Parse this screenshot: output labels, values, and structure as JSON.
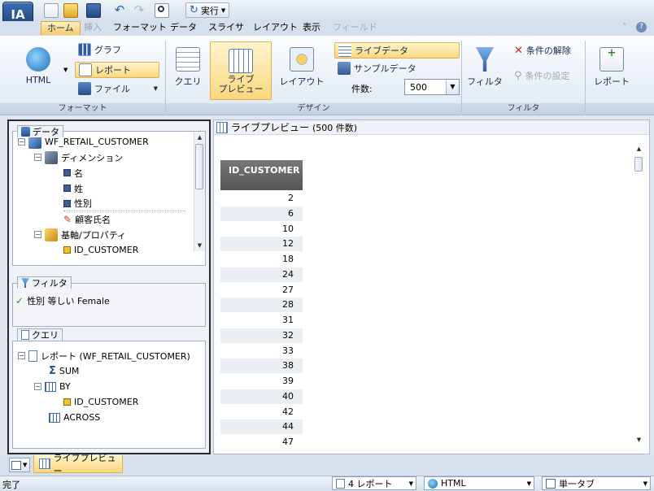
{
  "app": {
    "logo_text": "IA"
  },
  "toolbar": {
    "run_label": "実行"
  },
  "tabs": [
    {
      "label": "ホーム",
      "state": "active"
    },
    {
      "label": "挿入",
      "state": "disabled"
    },
    {
      "label": "フォーマット",
      "state": "normal"
    },
    {
      "label": "データ",
      "state": "normal"
    },
    {
      "label": "スライサ",
      "state": "normal"
    },
    {
      "label": "レイアウト",
      "state": "normal"
    },
    {
      "label": "表示",
      "state": "normal"
    },
    {
      "label": "フィールド",
      "state": "disabled"
    }
  ],
  "ribbon": {
    "format": {
      "label": "フォーマット",
      "html": "HTML",
      "graph": "グラフ",
      "report": "レポート",
      "file": "ファイル"
    },
    "design": {
      "label": "デザイン",
      "query": "クエリ",
      "live_preview": "ライブ\nプレビュー",
      "layout": "レイアウト",
      "live_data": "ライブデータ",
      "sample_data": "サンプルデータ",
      "count_label": "件数:",
      "count_value": "500"
    },
    "filter": {
      "label": "フィルタ",
      "filter": "フィルタ",
      "clear": "条件の解除",
      "set": "条件の設定"
    },
    "report": {
      "label": "レポート"
    }
  },
  "data_panel": {
    "title": "データ",
    "items": [
      {
        "label": "WF_RETAIL_CUSTOMER",
        "expander": "−",
        "icon": "cube-icon"
      },
      {
        "label": "ディメンション",
        "expander": "−",
        "icon": "dimension-icon"
      },
      {
        "label": "名",
        "expander": "",
        "icon": "field-icon"
      },
      {
        "label": "姓",
        "expander": "",
        "icon": "field-icon"
      },
      {
        "label": "性別",
        "expander": "",
        "icon": "field-icon"
      },
      {
        "label": "顧客氏名",
        "expander": "",
        "icon": "computed-field-icon"
      },
      {
        "label": "基軸/プロパティ",
        "expander": "−",
        "icon": "property-icon"
      },
      {
        "label": "ID_CUSTOMER",
        "expander": "",
        "icon": "measure-field-icon"
      }
    ]
  },
  "filter_panel": {
    "title": "フィルタ",
    "condition": "性別 等しい Female"
  },
  "query_panel": {
    "title": "クエリ",
    "items": [
      {
        "label": "レポート (WF_RETAIL_CUSTOMER)",
        "expander": "−",
        "icon": "report-icon"
      },
      {
        "label": "SUM",
        "expander": "",
        "icon": "sigma-icon"
      },
      {
        "label": "BY",
        "expander": "−",
        "icon": "grid-icon"
      },
      {
        "label": "ID_CUSTOMER",
        "expander": "",
        "icon": "measure-field-icon"
      },
      {
        "label": "ACROSS",
        "expander": "",
        "icon": "grid-icon"
      }
    ]
  },
  "preview": {
    "title": "ライブプレビュー",
    "count_text": "(500 件数)",
    "column_header": "ID_CUSTOMER",
    "values": [
      "2",
      "6",
      "10",
      "12",
      "18",
      "24",
      "27",
      "28",
      "31",
      "32",
      "33",
      "38",
      "39",
      "40",
      "42",
      "44",
      "47"
    ]
  },
  "bottom_tab": {
    "label": "ライブプレビュー"
  },
  "status": {
    "text": "完了",
    "reports": "4 レポート",
    "output": "HTML",
    "tab_mode": "単一タブ"
  },
  "colors": {
    "accent": "#f7c865",
    "header_bg": "#666666"
  }
}
